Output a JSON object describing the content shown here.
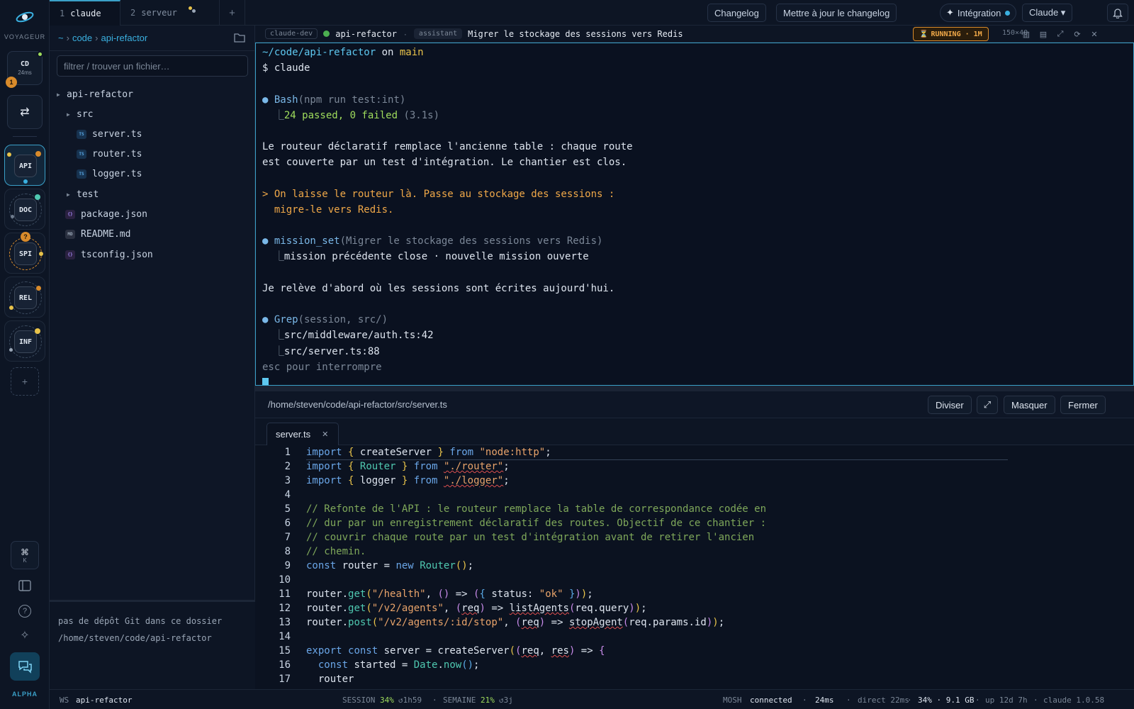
{
  "rail": {
    "brand": "VOYAGEUR",
    "session_card": {
      "label": "CD",
      "latency": "24ms",
      "badge": "1"
    },
    "swap_icon": "swap-arrows-icon",
    "workspaces": [
      {
        "label": "API",
        "active": true
      },
      {
        "label": "DOC",
        "active": false
      },
      {
        "label": "SPI",
        "active": false,
        "badge": "?"
      },
      {
        "label": "REL",
        "active": false
      },
      {
        "label": "INF",
        "active": false
      }
    ],
    "add_label": "+",
    "shortcut": {
      "symbol": "⌘",
      "key": "K"
    },
    "help_label": "?",
    "alpha_label": "ALPHA"
  },
  "tabs": [
    {
      "num": "1",
      "label": "claude",
      "active": true
    },
    {
      "num": "2",
      "label": "serveur",
      "active": false
    }
  ],
  "topbar": {
    "changelog": "Changelog",
    "update_changelog": "Mettre à jour le changelog",
    "integration": "Intégration",
    "model": "Claude ▾"
  },
  "explorer": {
    "crumb_root": "~",
    "crumb_1": "code",
    "crumb_2": "api-refactor",
    "filter_placeholder": "filtrer / trouver un fichier…",
    "tree": {
      "root": "api-refactor",
      "src": "src",
      "server": "server.ts",
      "router": "router.ts",
      "logger": "logger.ts",
      "test": "test",
      "package": "package.json",
      "readme": "README.md",
      "tsconfig": "tsconfig.json"
    },
    "git_message": "pas de dépôt Git dans ce dossier",
    "git_path": "/home/steven/code/api-refactor"
  },
  "terminal": {
    "host_chip": "claude-dev",
    "workspace": "api-refactor",
    "role_chip": "assistant",
    "mission": "Migrer le stockage des sessions vers Redis",
    "status": "RUNNING · 1M",
    "size": "150×40",
    "lines": {
      "prompt_path": "~/code/api-refactor",
      "prompt_on": " on ",
      "prompt_branch": "main",
      "cmd": "$ claude",
      "bash_tool": "Bash",
      "bash_args": "(npm run test:int)",
      "bash_result": "24 passed, 0 failed",
      "bash_time": " (3.1s)",
      "msg1a": "Le routeur déclaratif remplace l'ancienne table : chaque route",
      "msg1b": "est couverte par un test d'intégration. Le chantier est clos.",
      "user1a": "> On laisse le routeur là. Passe au stockage des sessions :",
      "user1b": "  migre-le vers Redis.",
      "mission_tool": "mission_set",
      "mission_args": "(Migrer le stockage des sessions vers Redis)",
      "mission_result": "mission précédente close · nouvelle mission ouverte",
      "msg2": "Je relève d'abord où les sessions sont écrites aujourd'hui.",
      "grep_tool": "Grep",
      "grep_args": "(session, src/)",
      "grep_r1": "src/middleware/auth.ts:42",
      "grep_r2": "src/server.ts:88",
      "esc": "esc pour interrompre"
    }
  },
  "editor": {
    "path": "/home/steven/code/api-refactor/src/server.ts",
    "split": "Diviser",
    "hide": "Masquer",
    "close": "Fermer",
    "tab": "server.ts",
    "line_numbers": [
      "1",
      "2",
      "3",
      "4",
      "5",
      "6",
      "7",
      "8",
      "9",
      "10",
      "11",
      "12",
      "13",
      "14",
      "15",
      "16",
      "17"
    ],
    "comment": [
      "// Refonte de l'API : le routeur remplace la table de correspondance codée en",
      "// dur par un enregistrement déclaratif des routes. Objectif de ce chantier :",
      "// couvrir chaque route par un test d'intégration avant de retirer l'ancien",
      "// chemin."
    ]
  },
  "status": {
    "ws_label": "WS",
    "ws_value": "api-refactor",
    "session_label": "SESSION",
    "session_pct": "34%",
    "session_time": "↺1h59",
    "week_label": "SEMAINE",
    "week_pct": "21%",
    "week_time": "↺3j",
    "mosh_label": "MOSH",
    "mosh_value": "connected",
    "latency": "24ms",
    "direct": "direct 22ms",
    "mem": "34% · 9.1 GB",
    "uptime": "up 12d 7h",
    "version": "claude 1.0.58"
  },
  "colors": {
    "accent": "#3aa0c8",
    "running": "#f0a848",
    "ok": "#9fdc5c"
  }
}
